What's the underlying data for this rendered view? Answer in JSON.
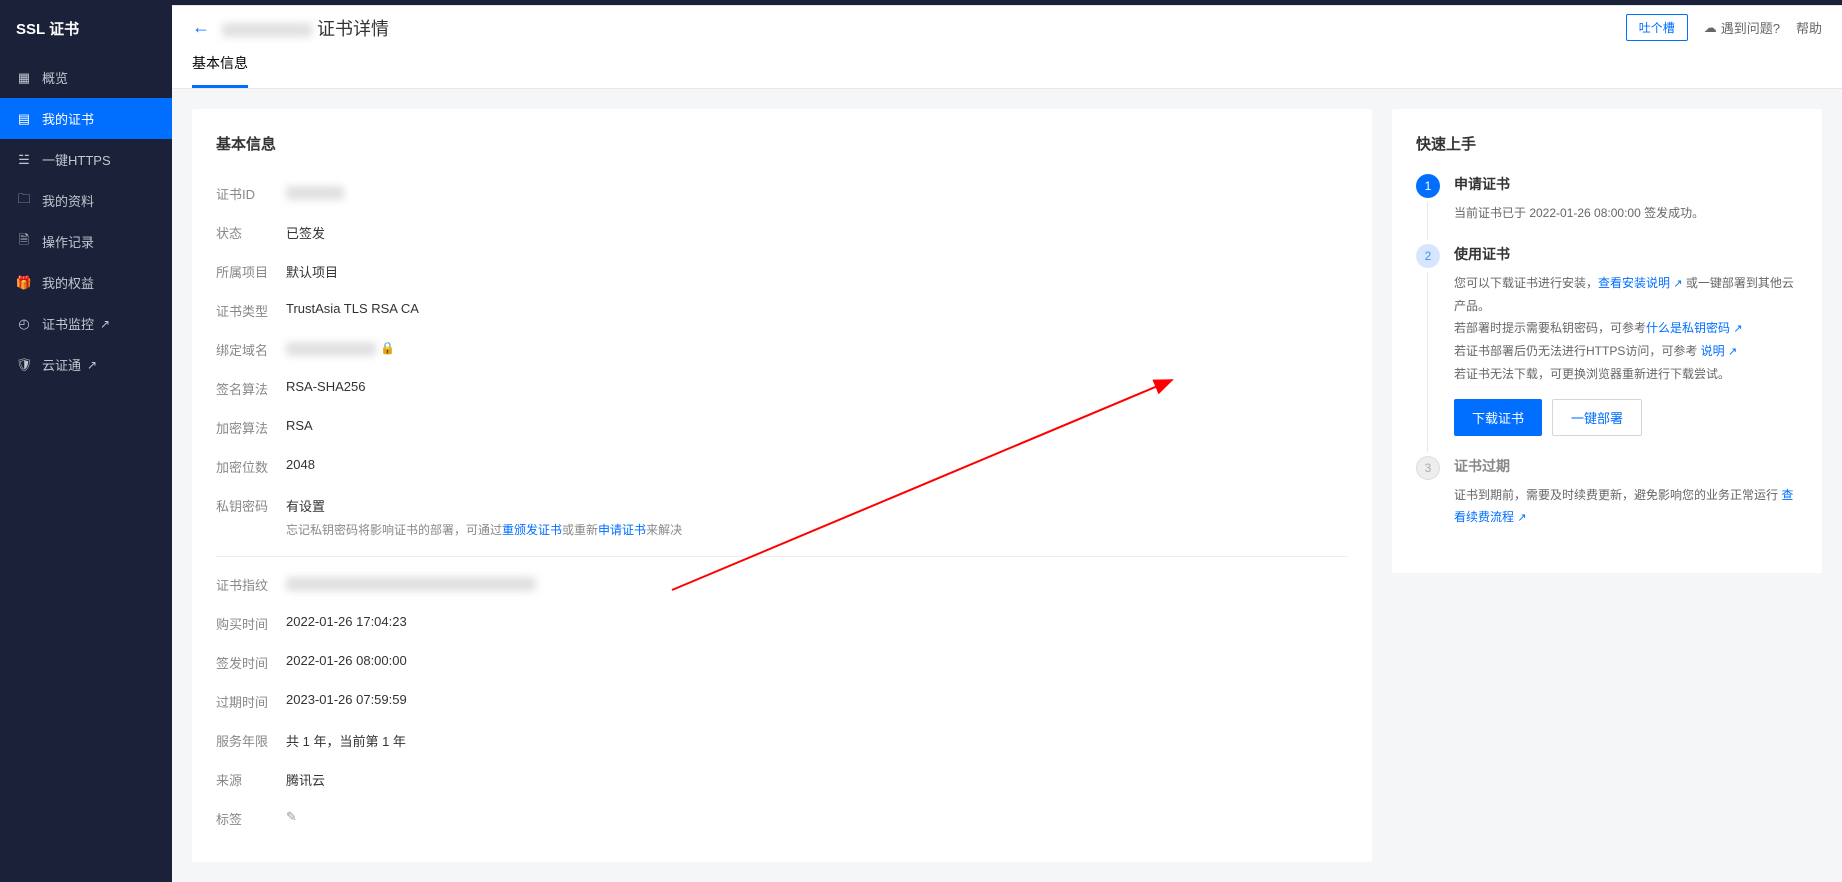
{
  "sidebar": {
    "title": "SSL 证书",
    "items": [
      {
        "label": "概览",
        "icon": "grid"
      },
      {
        "label": "我的证书",
        "icon": "doc",
        "active": true
      },
      {
        "label": "一键HTTPS",
        "icon": "https"
      },
      {
        "label": "我的资料",
        "icon": "folder"
      },
      {
        "label": "操作记录",
        "icon": "log"
      },
      {
        "label": "我的权益",
        "icon": "gift"
      },
      {
        "label": "证书监控",
        "icon": "monitor",
        "ext": true
      },
      {
        "label": "云证通",
        "icon": "shield",
        "ext": true
      }
    ]
  },
  "header": {
    "title_suffix": "证书详情",
    "feedback_btn": "吐个槽",
    "faq": "遇到问题?",
    "help": "帮助"
  },
  "tabs": [
    {
      "label": "基本信息",
      "active": true
    }
  ],
  "basic": {
    "section_title": "基本信息",
    "rows": {
      "id_label": "证书ID",
      "status_label": "状态",
      "status_value": "已签发",
      "project_label": "所属项目",
      "project_value": "默认项目",
      "type_label": "证书类型",
      "type_value": "TrustAsia TLS RSA CA",
      "domain_label": "绑定域名",
      "sign_algo_label": "签名算法",
      "sign_algo_value": "RSA-SHA256",
      "enc_algo_label": "加密算法",
      "enc_algo_value": "RSA",
      "bits_label": "加密位数",
      "bits_value": "2048",
      "pkpass_label": "私钥密码",
      "pkpass_value": "有设置",
      "pkpass_hint_prefix": "忘记私钥密码将影响证书的部署，可通过",
      "pkpass_hint_link1": "重颁发证书",
      "pkpass_hint_mid": "或重新",
      "pkpass_hint_link2": "申请证书",
      "pkpass_hint_suffix": "来解决",
      "fingerprint_label": "证书指纹",
      "buy_time_label": "购买时间",
      "buy_time_value": "2022-01-26 17:04:23",
      "issue_time_label": "签发时间",
      "issue_time_value": "2022-01-26 08:00:00",
      "expire_time_label": "过期时间",
      "expire_time_value": "2023-01-26 07:59:59",
      "years_label": "服务年限",
      "years_value": "共 1 年，当前第 1 年",
      "source_label": "来源",
      "source_value": "腾讯云",
      "tag_label": "标签"
    }
  },
  "quickstart": {
    "title": "快速上手",
    "step1": {
      "title": "申请证书",
      "desc": "当前证书已于 2022-01-26 08:00:00 签发成功。"
    },
    "step2": {
      "title": "使用证书",
      "line1_pre": "您可以下载证书进行安装，",
      "line1_link": "查看安装说明",
      "line1_suf": " 或一键部署到其他云产品。",
      "line2_pre": "若部署时提示需要私钥密码，可参考",
      "line2_link": "什么是私钥密码",
      "line3_pre": "若证书部署后仍无法进行HTTPS访问，可参考 ",
      "line3_link": "说明",
      "line4": "若证书无法下载，可更换浏览器重新进行下载尝试。",
      "btn_download": "下载证书",
      "btn_deploy": "一键部署"
    },
    "step3": {
      "title": "证书过期",
      "desc_pre": "证书到期前，需要及时续费更新，避免影响您的业务正常运行 ",
      "desc_link": "查看续费流程"
    }
  }
}
